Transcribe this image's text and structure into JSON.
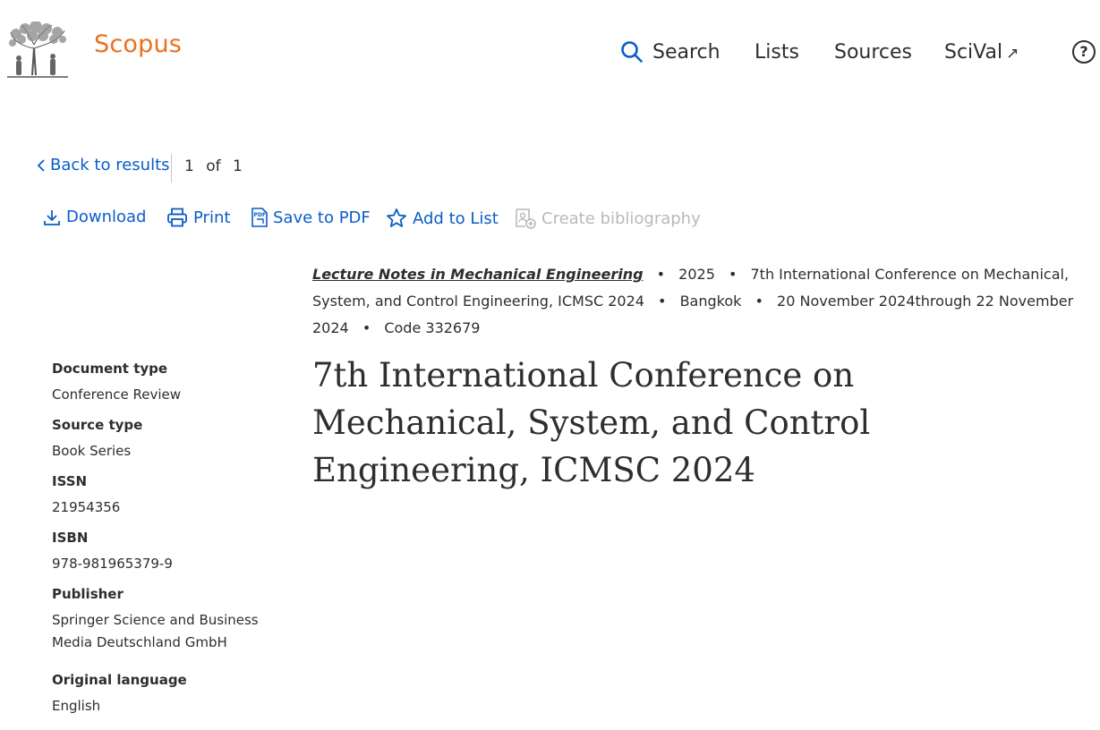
{
  "header": {
    "brand": "Scopus",
    "nav": {
      "search": "Search",
      "lists": "Lists",
      "sources": "Sources",
      "scival": "SciVal",
      "scival_arrow": "↗"
    },
    "help": "?"
  },
  "back": {
    "label": "Back to results",
    "pager": {
      "current": "1",
      "of": "of",
      "total": "1"
    }
  },
  "actions": {
    "download": "Download",
    "print": "Print",
    "save_pdf": "Save to PDF",
    "add_to_list": "Add to List",
    "create_bibliography": "Create bibliography"
  },
  "source": {
    "journal": "Lecture Notes in Mechanical Engineering",
    "year": "2025",
    "conference": "7th International Conference on Mechanical, System, and Control Engineering, ICMSC 2024",
    "location": "Bangkok",
    "dates": "20 November 2024through 22 November 2024",
    "code": "Code 332679",
    "separator": "•"
  },
  "title": "7th International Conference on Mechanical, System, and Control Engineering, ICMSC 2024",
  "meta": [
    {
      "label": "Document type",
      "value": "Conference Review"
    },
    {
      "label": "Source type",
      "value": "Book Series"
    },
    {
      "label": "ISSN",
      "value": "21954356"
    },
    {
      "label": "ISBN",
      "value": "978-981965379-9"
    },
    {
      "label": "Publisher",
      "value": "Springer Science and Business Media Deutschland GmbH"
    },
    {
      "label": "Original language",
      "value": "English"
    }
  ],
  "colors": {
    "brand": "#e9711c",
    "link": "#0a5cc8",
    "disabled": "#b9b9b9",
    "text": "#2e2e2e"
  },
  "icons": [
    "elsevier-tree-logo",
    "search-icon",
    "external-link-icon",
    "help-icon",
    "chevron-left-icon",
    "download-icon",
    "print-icon",
    "pdf-icon",
    "star-icon",
    "bibliography-icon"
  ]
}
